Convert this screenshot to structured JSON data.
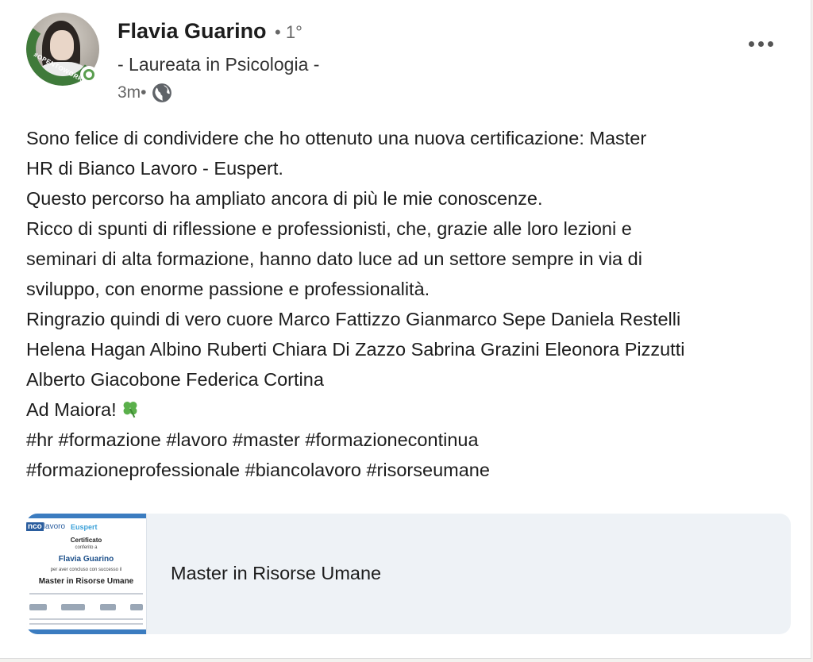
{
  "author": {
    "name": "Flavia Guarino",
    "degree": "• 1°",
    "headline": "- Laureata in Psicologia -",
    "time": "3m•",
    "avatar_badge": "#OPENTOWORK"
  },
  "post": {
    "lines": [
      "Sono felice di condividere che ho ottenuto una nuova certificazione: Master",
      "HR di Bianco Lavoro - Euspert.",
      "Questo percorso ha ampliato ancora di più le mie conoscenze.",
      "Ricco di spunti di riflessione e professionisti, che, grazie alle loro lezioni e",
      "seminari di alta formazione, hanno dato luce ad un settore sempre in via di",
      "sviluppo, con enorme passione e professionalità.",
      "Ringrazio quindi di vero cuore Marco Fattizzo Gianmarco Sepe Daniela Restelli",
      "Helena Hagan Albino Ruberti Chiara Di Zazzo Sabrina Grazini Eleonora Pizzutti",
      "Alberto Giacobone Federica Cortina",
      "Ad Maiora!",
      "#hr #formazione #lavoro #master #formazionecontinua",
      "#formazioneprofessionale #biancolavoro #risorseumane"
    ]
  },
  "attachment": {
    "title": "Master in Risorse Umane",
    "thumbnail": {
      "logo_left_mark": "nco",
      "logo_left_text": "lavoro",
      "logo_right": "Euspert",
      "heading": "Certificato",
      "conferred": "conferito a",
      "name": "Flavia Guarino",
      "completed": "per aver concluso con successo il",
      "course": "Master in Risorse Umane"
    }
  },
  "icons": {
    "more": "more-horizontal-icon",
    "visibility": "globe-icon",
    "emoji": "four-leaf-clover-icon"
  },
  "colors": {
    "open_to_work": "#3f7a3a",
    "attachment_bg": "#eef2f6"
  }
}
